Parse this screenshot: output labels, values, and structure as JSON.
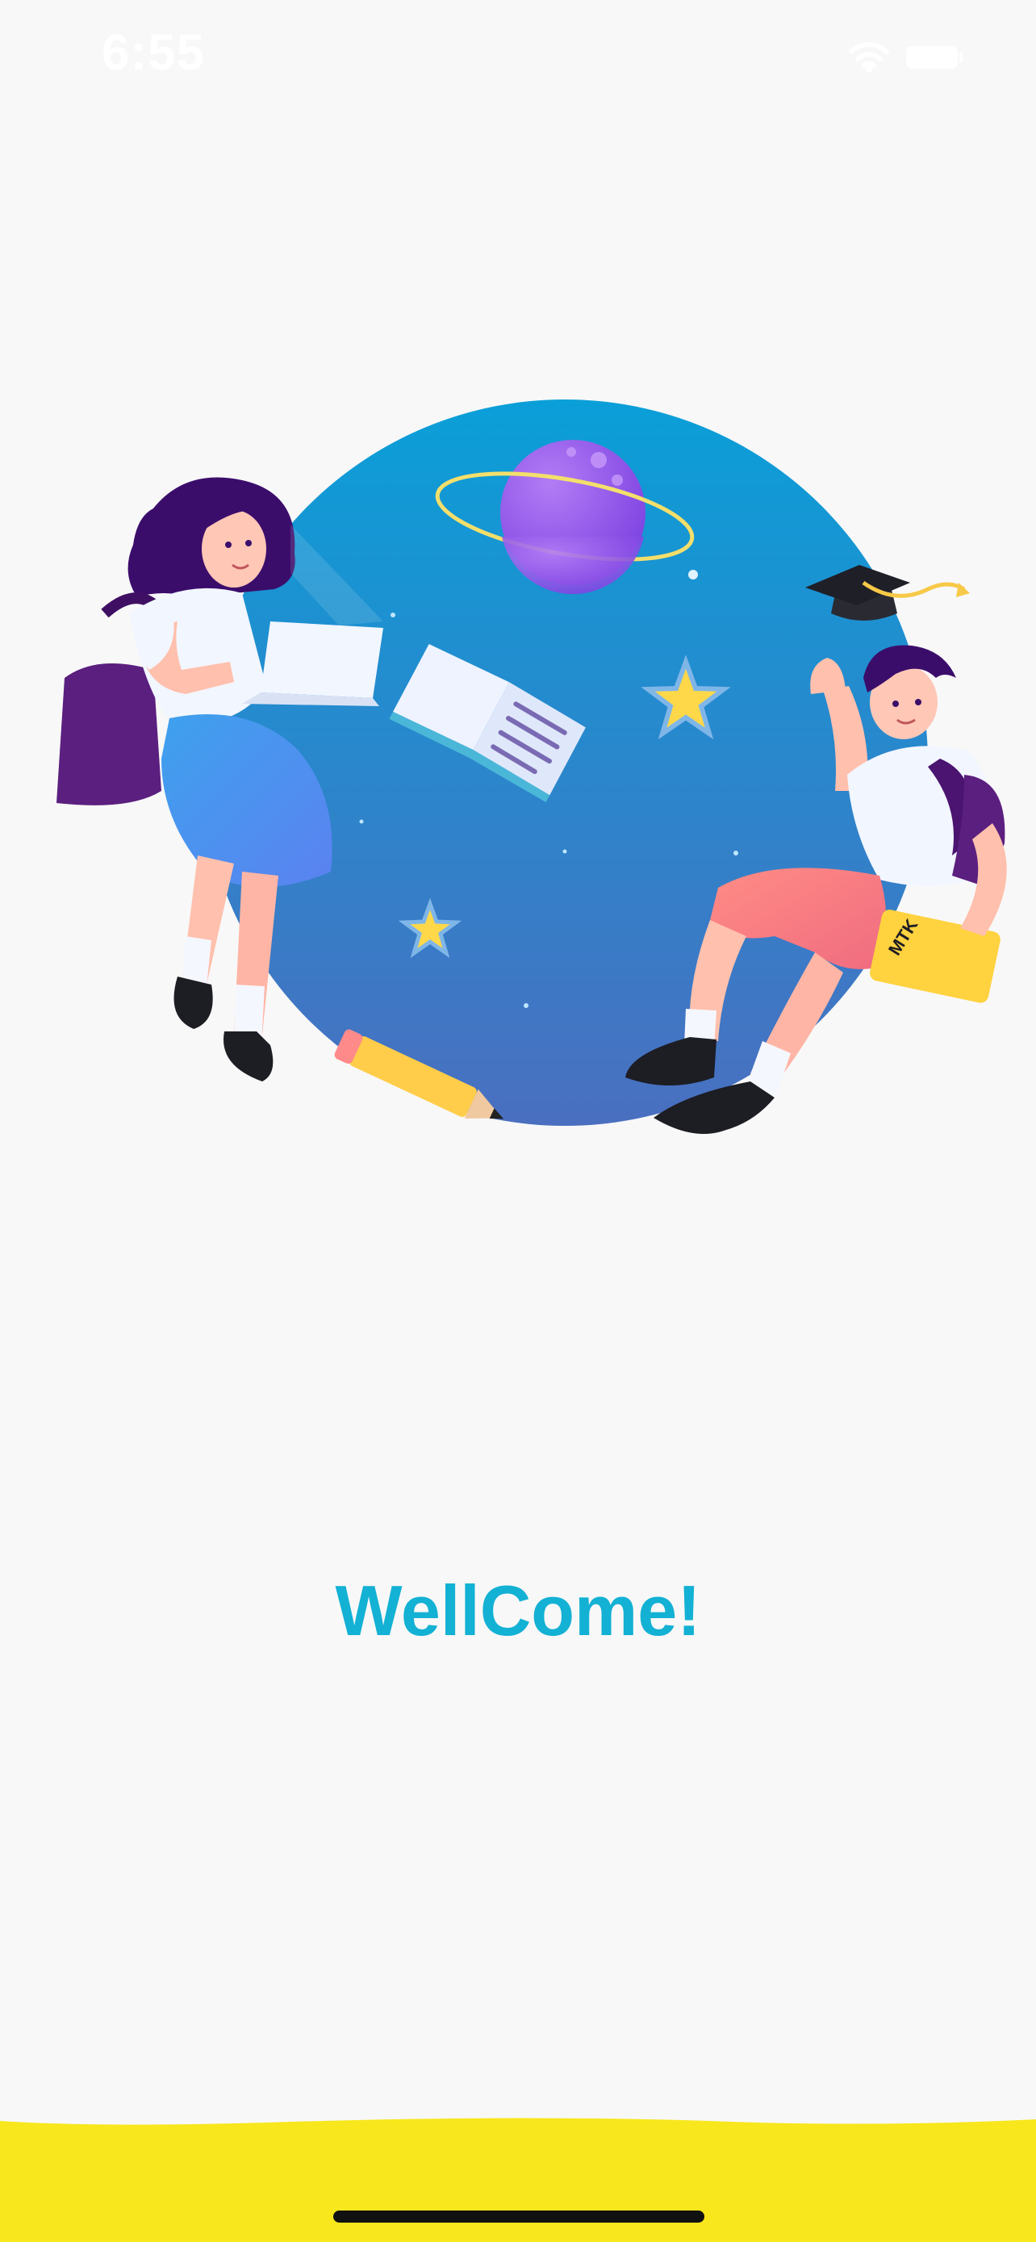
{
  "status_bar": {
    "time": "6:55",
    "icons": [
      "wifi-icon",
      "battery-icon"
    ]
  },
  "illustration": {
    "book_label": "MTK",
    "elements": [
      "planet",
      "open-book",
      "graduation-cap",
      "star",
      "pencil",
      "laptop",
      "student-girl",
      "student-boy"
    ]
  },
  "welcome": {
    "title": "WellCome!"
  },
  "colors": {
    "background": "#f8f8f8",
    "accent": "#13b1d4",
    "circle_top": "#0a9fd8",
    "circle_bottom": "#4a6fc0",
    "bottom_band": "#f8e71c",
    "home_indicator": "#111111"
  }
}
